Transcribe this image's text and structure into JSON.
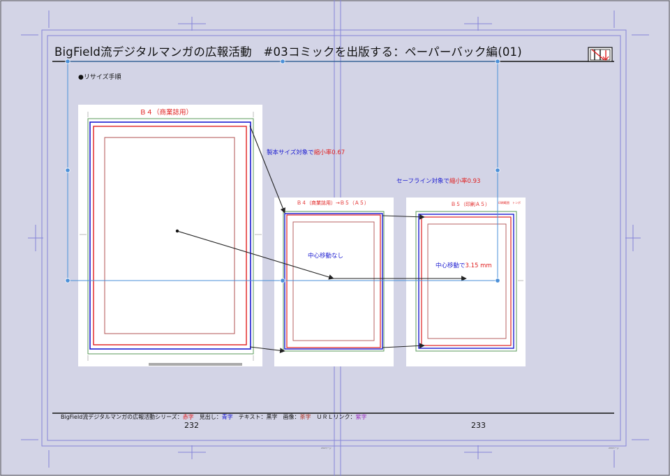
{
  "page": {
    "title": "BigField流デジタルマンガの広報活動　#03コミックを出版する：ペーパーバック編(01)",
    "heading": "●リサイズ手順"
  },
  "diagram": {
    "b4_label": "Ｂ４（商業誌用）",
    "b4_to_b5_label": "Ｂ４（商業誌用）→Ｂ５（Ａ５）",
    "b5_label": "Ｂ５（印刷Ａ５）",
    "b5_small_note": "印刷範囲　トンボ",
    "bind_annotation": {
      "prefix": "製本サイズ対象で",
      "emph": "縮小率0.67"
    },
    "safe_annotation": {
      "prefix": "セーフライン対象で",
      "emph": "縮小率0.93"
    },
    "no_move": "中心移動なし",
    "center_move": {
      "prefix": "中心移動で",
      "emph": "3.15 mm"
    }
  },
  "footer": {
    "series": "BigField流デジタルマンガの広報活動シリーズ：",
    "red_label": "赤字",
    "heading_label": "　見出し：",
    "blue_label": "青字",
    "text_label": "　テキスト：黒字　画像：",
    "brown_label": "茶字",
    "url_label": "　ＵＲＬリンク：",
    "purple_label": "紫字",
    "page_left": "232",
    "page_right": "233",
    "tiny_left": "232ページ",
    "tiny_right": "233ページ"
  },
  "colors": {
    "background": "#d3d4e6",
    "guide": "#8080d8",
    "selection": "#4a8fd8",
    "red": "#e02020",
    "blue": "#1a1ad0"
  },
  "icons": [
    "logo-mark-icon"
  ]
}
